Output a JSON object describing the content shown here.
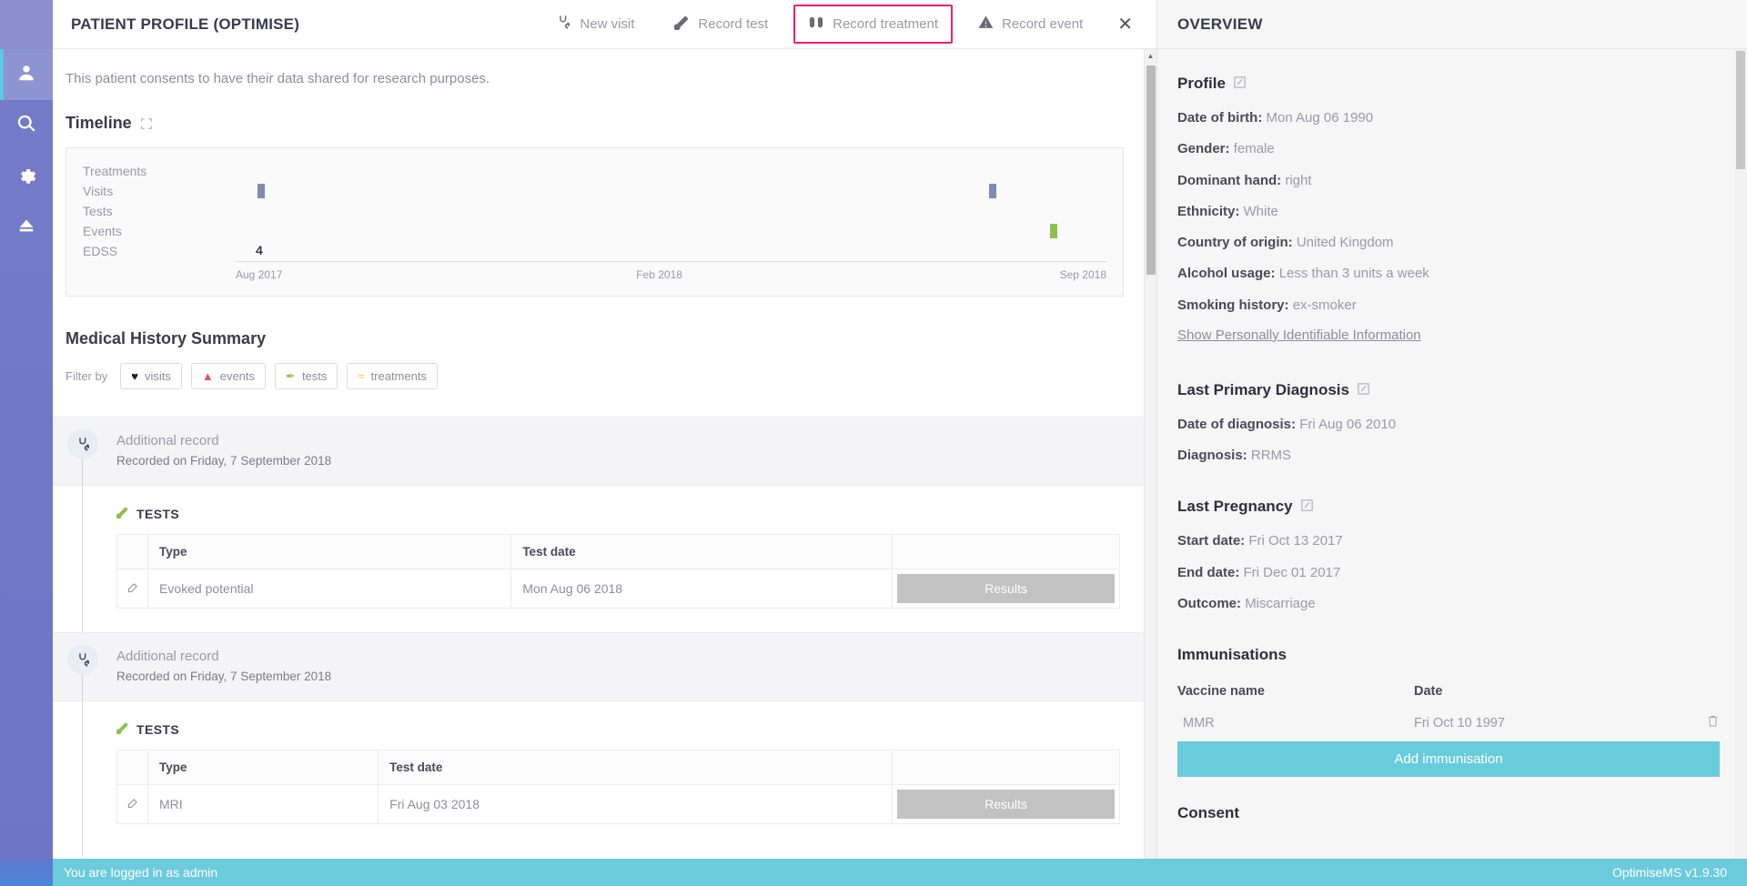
{
  "window": {
    "title": "PATIENT PROFILE (OPTIMISE)"
  },
  "sidebar": {
    "items": [
      {
        "name": "patient",
        "icon": "person-icon",
        "active": true
      },
      {
        "name": "search",
        "icon": "search-icon",
        "active": false
      },
      {
        "name": "settings",
        "icon": "gear-icon",
        "active": false
      },
      {
        "name": "logout",
        "icon": "eject-icon",
        "active": false
      }
    ]
  },
  "toolbar": {
    "new_visit": "New visit",
    "record_test": "Record test",
    "record_treatment": "Record treatment",
    "record_event": "Record event",
    "close": "✕",
    "highlight_color": "#ec1e79"
  },
  "main": {
    "consent_note": "This patient consents to have their data shared for research purposes.",
    "timeline_title": "Timeline",
    "medical_history_title": "Medical History Summary",
    "filter_label": "Filter by",
    "filters": [
      {
        "label": "visits",
        "glyph": "♥",
        "color": "#1b1b24",
        "icon": "heart-icon"
      },
      {
        "label": "events",
        "glyph": "▲",
        "color": "#ef5350",
        "icon": "warning-icon"
      },
      {
        "label": "tests",
        "glyph": "✒",
        "color": "#8bc34a",
        "icon": "test-tube-icon"
      },
      {
        "label": "treatments",
        "glyph": "≈",
        "color": "#f5c242",
        "icon": "pills-icon"
      }
    ],
    "records": [
      {
        "title": "Additional record",
        "subtitle": "Recorded on Friday, 7 September 2018",
        "body_title": "TESTS",
        "columns": [
          "",
          "Type",
          "Test date",
          ""
        ],
        "rows": [
          {
            "type": "Evoked potential",
            "date": "Mon Aug 06 2018",
            "action": "Results"
          }
        ]
      },
      {
        "title": "Additional record",
        "subtitle": "Recorded on Friday, 7 September 2018",
        "body_title": "TESTS",
        "columns": [
          "",
          "Type",
          "Test date",
          ""
        ],
        "rows": [
          {
            "type": "MRI",
            "date": "Fri Aug 03 2018",
            "action": "Results"
          }
        ]
      }
    ]
  },
  "chart_data": {
    "type": "timeline",
    "title": "Timeline",
    "categories": [
      "Treatments",
      "Visits",
      "Tests",
      "Events",
      "EDSS"
    ],
    "xlabel": "",
    "ylabel": "",
    "axis_ticks": [
      {
        "label": "Aug 2017",
        "position_pct": 0
      },
      {
        "label": "Feb 2018",
        "position_pct": 46
      },
      {
        "label": "Sep 2018",
        "position_pct": 95
      }
    ],
    "series": [
      {
        "name": "Treatments",
        "color": "#f5c242",
        "points": []
      },
      {
        "name": "Visits",
        "color": "#7d8cb5",
        "points": [
          {
            "position_pct": 2.5,
            "value": 1
          },
          {
            "position_pct": 86.5,
            "value": 1
          }
        ]
      },
      {
        "name": "Tests",
        "color": "#8bc34a",
        "points": []
      },
      {
        "name": "Events",
        "color": "#8bc34a",
        "points": [
          {
            "position_pct": 93.5,
            "value": 1
          }
        ]
      },
      {
        "name": "EDSS",
        "color": "#3b3b4a",
        "points": [
          {
            "position_pct": 2.5,
            "value": 4,
            "label": "4"
          }
        ]
      }
    ]
  },
  "overview": {
    "header": "OVERVIEW",
    "profile": {
      "heading": "Profile",
      "fields": [
        {
          "key": "Date of birth:",
          "value": "Mon Aug 06 1990"
        },
        {
          "key": "Gender:",
          "value": "female"
        },
        {
          "key": "Dominant hand:",
          "value": "right"
        },
        {
          "key": "Ethnicity:",
          "value": "White"
        },
        {
          "key": "Country of origin:",
          "value": "United Kingdom"
        },
        {
          "key": "Alcohol usage:",
          "value": "Less than 3 units a week"
        },
        {
          "key": "Smoking history:",
          "value": "ex-smoker"
        }
      ],
      "pii_link": "Show Personally Identifiable Information"
    },
    "diagnosis": {
      "heading": "Last Primary Diagnosis",
      "fields": [
        {
          "key": "Date of diagnosis:",
          "value": "Fri Aug 06 2010"
        },
        {
          "key": "Diagnosis:",
          "value": "RRMS"
        }
      ]
    },
    "pregnancy": {
      "heading": "Last Pregnancy",
      "fields": [
        {
          "key": "Start date:",
          "value": "Fri Oct 13 2017"
        },
        {
          "key": "End date:",
          "value": "Fri Dec 01 2017"
        },
        {
          "key": "Outcome:",
          "value": "Miscarriage"
        }
      ]
    },
    "immunisations": {
      "heading": "Immunisations",
      "columns": {
        "name": "Vaccine name",
        "date": "Date"
      },
      "rows": [
        {
          "name": "MMR",
          "date": "Fri Oct 10 1997"
        }
      ],
      "add_button": "Add immunisation",
      "button_color": "#69ccdd"
    },
    "consent": {
      "heading": "Consent"
    }
  },
  "statusbar": {
    "login_text": "You are logged in as admin",
    "version": "OptimiseMS v1.9.30",
    "color": "#6bcbdd"
  }
}
